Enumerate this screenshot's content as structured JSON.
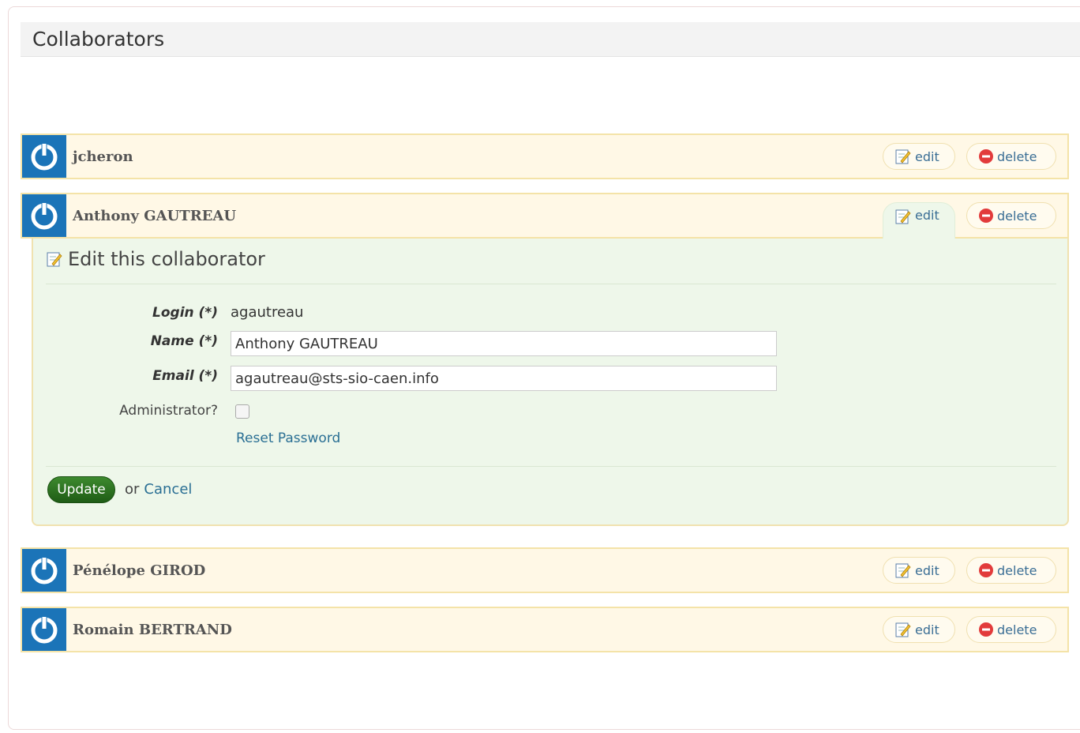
{
  "page": {
    "title": "Collaborators"
  },
  "buttons": {
    "edit": "edit",
    "delete": "delete"
  },
  "collaborators": [
    {
      "name": "jcheron"
    },
    {
      "name": "Anthony GAUTREAU"
    },
    {
      "name": "Pénélope GIROD"
    },
    {
      "name": "Romain BERTRAND"
    }
  ],
  "edit_form": {
    "title": "Edit this collaborator",
    "login_label": "Login (*)",
    "login_value": "agautreau",
    "name_label": "Name (*)",
    "name_value": "Anthony GAUTREAU",
    "email_label": "Email (*)",
    "email_value": "agautreau@sts-sio-caen.info",
    "admin_label": "Administrator?",
    "admin_checked": false,
    "reset_password": "Reset Password",
    "update_button": "Update",
    "or_text": "or",
    "cancel_link": "Cancel"
  },
  "colors": {
    "avatar_bg": "#1b74b8",
    "row_bg": "#fff8e6",
    "panel_bg": "#eef7ea",
    "update_green": "#2e7a22"
  }
}
